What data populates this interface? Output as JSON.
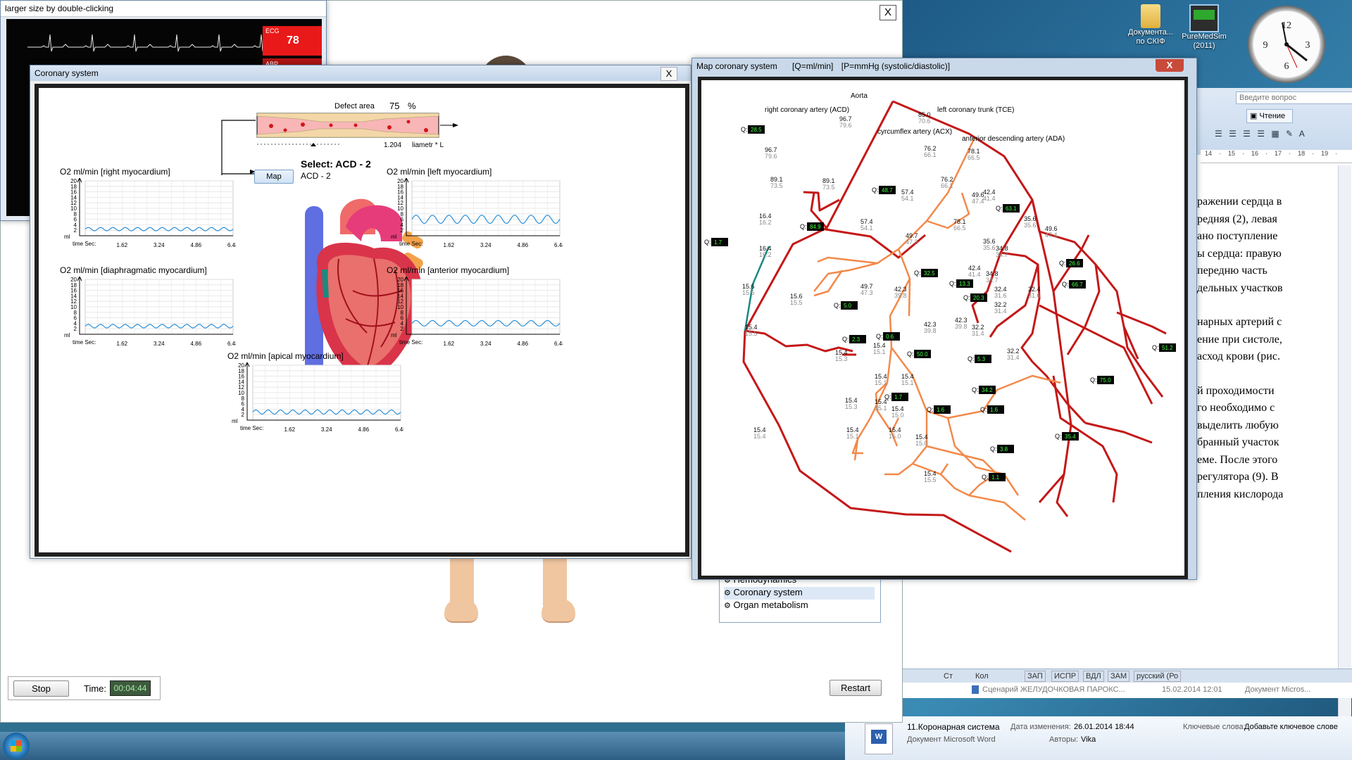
{
  "desktop": {
    "icons": [
      {
        "label": "Документа...\nпо СКІФ"
      },
      {
        "label": "PureMedSim\n(2011)"
      }
    ]
  },
  "main_window": {
    "top_close": "X",
    "stop_label": "Stop",
    "time_label": "Time:",
    "time_value": "00:04:44",
    "restart_label": "Restart",
    "side_menu": [
      {
        "label": "Hemodynamics"
      },
      {
        "label": "Coronary system"
      },
      {
        "label": "Organ metabolism"
      }
    ]
  },
  "monitor_window": {
    "title": "larger size by double-clicking",
    "ecg_label": "ECG",
    "ecg_value": "78",
    "abp_label": "ABP"
  },
  "coronary_window": {
    "title": "Coronary system",
    "close": "X",
    "defect_label": "Defect area",
    "defect_value": "75",
    "defect_unit": "%",
    "diameter_value": "1.204",
    "diameter_label": "liametr * L",
    "select_label": "Select: ACD - 2",
    "select_sub": "ACD - 2",
    "map_button": "Map",
    "charts_common": {
      "yticks": [
        "20",
        "18",
        "16",
        "14",
        "12",
        "10",
        "8",
        "6",
        "4",
        "2"
      ],
      "yunit": "ml",
      "xprefix": "time Sec:",
      "xticks": [
        "1.62",
        "3.24",
        "4.86",
        "6.48"
      ]
    },
    "charts": [
      {
        "title": "O2 ml/min [right myocardium]"
      },
      {
        "title": "O2 ml/min [left myocardium]"
      },
      {
        "title": "O2 ml/min [diaphragmatic myocardium]"
      },
      {
        "title": "O2 ml/min [anterior myocardium]"
      },
      {
        "title": "O2 ml/min [apical myocardium]"
      }
    ]
  },
  "chart_data": [
    {
      "type": "line",
      "title": "O2 ml/min [right myocardium]",
      "ylabel": "ml",
      "xlabel": "time Sec:",
      "ylim": [
        0,
        20
      ],
      "xlim": [
        0,
        6.48
      ],
      "x_ticks": [
        1.62,
        3.24,
        4.86,
        6.48
      ],
      "series": [
        {
          "color": "#2b8fd8",
          "baseline": 1.8,
          "amplitude": 1.2,
          "cycles": 12
        }
      ]
    },
    {
      "type": "line",
      "title": "O2 ml/min [left myocardium]",
      "ylabel": "ml",
      "xlabel": "time Sec:",
      "ylim": [
        0,
        20
      ],
      "xlim": [
        0,
        6.48
      ],
      "x_ticks": [
        1.62,
        3.24,
        4.86,
        6.48
      ],
      "series": [
        {
          "color": "#2b8fd8",
          "baseline": 4.5,
          "amplitude": 3.0,
          "cycles": 9
        }
      ]
    },
    {
      "type": "line",
      "title": "O2 ml/min [diaphragmatic myocardium]",
      "ylabel": "ml",
      "xlabel": "time Sec:",
      "ylim": [
        0,
        20
      ],
      "xlim": [
        0,
        6.48
      ],
      "x_ticks": [
        1.62,
        3.24,
        4.86,
        6.48
      ],
      "series": [
        {
          "color": "#2b8fd8",
          "baseline": 2.3,
          "amplitude": 1.3,
          "cycles": 12
        }
      ]
    },
    {
      "type": "line",
      "title": "O2 ml/min [anterior myocardium]",
      "ylabel": "ml",
      "xlabel": "time Sec:",
      "ylim": [
        0,
        20
      ],
      "xlim": [
        0,
        6.48
      ],
      "x_ticks": [
        1.62,
        3.24,
        4.86,
        6.48
      ],
      "series": [
        {
          "color": "#2b8fd8",
          "baseline": 3.0,
          "amplitude": 2.0,
          "cycles": 9
        }
      ]
    },
    {
      "type": "line",
      "title": "O2 ml/min [apical myocardium]",
      "ylabel": "ml",
      "xlabel": "time Sec:",
      "ylim": [
        0,
        20
      ],
      "xlim": [
        0,
        6.48
      ],
      "x_ticks": [
        1.62,
        3.24,
        4.86,
        6.48
      ],
      "series": [
        {
          "color": "#2b8fd8",
          "baseline": 2.2,
          "amplitude": 1.5,
          "cycles": 12
        }
      ]
    }
  ],
  "map_window": {
    "title": "Map coronary system",
    "units_q": "[Q=ml/min]",
    "units_p": "[P=mmHg (systolic/diastolic)]",
    "close": "X",
    "vessel_labels": [
      "Aorta",
      "right coronary artery (ACD)",
      "left coronary trunk (TCE)",
      "cyrcumflex artery (ACX)",
      "anterior descending artery (ADA)"
    ],
    "flow_labels": [
      {
        "q": "28.5"
      },
      {
        "q": "48.7"
      },
      {
        "q": "84.9"
      },
      {
        "q": "1.7"
      },
      {
        "q": "63.1"
      },
      {
        "q": "26.6"
      },
      {
        "q": "32.5"
      },
      {
        "q": "13.3"
      },
      {
        "q": "20.3"
      },
      {
        "q": "66.7"
      },
      {
        "q": "5.0"
      },
      {
        "q": "2.3"
      },
      {
        "q": "0.6"
      },
      {
        "q": "50.0"
      },
      {
        "q": "51.2"
      },
      {
        "q": "5.3"
      },
      {
        "q": "75.0"
      },
      {
        "q": "34.2"
      },
      {
        "q": "1.7"
      },
      {
        "q": "1.6"
      },
      {
        "q": "1.6"
      },
      {
        "q": "35.4"
      },
      {
        "q": "3.8"
      },
      {
        "q": "1.1"
      }
    ],
    "pressure_labels": [
      {
        "s": "96.7",
        "d": "79.6"
      },
      {
        "s": "85.0",
        "d": "70.6"
      },
      {
        "s": "96.7",
        "d": "79.6"
      },
      {
        "s": "76.2",
        "d": "66.1"
      },
      {
        "s": "78.1",
        "d": "66.5"
      },
      {
        "s": "89.1",
        "d": "73.5"
      },
      {
        "s": "89.1",
        "d": "73.5"
      },
      {
        "s": "76.2",
        "d": "66.1"
      },
      {
        "s": "57.4",
        "d": "54.1"
      },
      {
        "s": "49.6",
        "d": "47.4"
      },
      {
        "s": "42.4",
        "d": "41.4"
      },
      {
        "s": "16.4",
        "d": "16.2"
      },
      {
        "s": "57.4",
        "d": "54.1"
      },
      {
        "s": "78.1",
        "d": "66.5"
      },
      {
        "s": "35.6",
        "d": "35.6"
      },
      {
        "s": "49.6",
        "d": "47.4"
      },
      {
        "s": "49.7",
        "d": "47.3"
      },
      {
        "s": "35.6",
        "d": "35.6"
      },
      {
        "s": "34.8",
        "d": "34.7"
      },
      {
        "s": "16.4",
        "d": "16.2"
      },
      {
        "s": "42.4",
        "d": "41.4"
      },
      {
        "s": "34.8",
        "d": "34.7"
      },
      {
        "s": "15.6",
        "d": "15.5"
      },
      {
        "s": "49.7",
        "d": "47.3"
      },
      {
        "s": "42.3",
        "d": "39.8"
      },
      {
        "s": "32.4",
        "d": "31.6"
      },
      {
        "s": "32.4",
        "d": "31.6"
      },
      {
        "s": "15.6",
        "d": "15.5"
      },
      {
        "s": "32.2",
        "d": "31.4"
      },
      {
        "s": "15.4",
        "d": "15.5"
      },
      {
        "s": "42.3",
        "d": "39.8"
      },
      {
        "s": "42.3",
        "d": "39.8"
      },
      {
        "s": "32.2",
        "d": "31.4"
      },
      {
        "s": "15.4",
        "d": "15.3"
      },
      {
        "s": "15.4",
        "d": "15.1"
      },
      {
        "s": "32.2",
        "d": "31.4"
      },
      {
        "s": "15.4",
        "d": "15.1"
      },
      {
        "s": "15.4",
        "d": "15.1"
      },
      {
        "s": "15.4",
        "d": "15.3"
      },
      {
        "s": "15.4",
        "d": "15.1"
      },
      {
        "s": "15.4",
        "d": "15.0"
      },
      {
        "s": "15.4",
        "d": "15.4"
      },
      {
        "s": "15.4",
        "d": "15.1"
      },
      {
        "s": "15.4",
        "d": "15.0"
      },
      {
        "s": "15.4",
        "d": "15.0"
      },
      {
        "s": "15.4",
        "d": "15.5"
      }
    ]
  },
  "word": {
    "search_placeholder": "Введите вопрос",
    "read_button": "Чтение",
    "ruler": [
      "14",
      "·",
      "15",
      "·",
      "16",
      "·",
      "17",
      "·",
      "18",
      "·",
      "19",
      "·"
    ],
    "lines": [
      "ражении сердца в",
      "редняя (2), левая",
      "ано поступление",
      "ы сердца: правую",
      "передню часть",
      "дельных участков",
      "",
      "нарных артерий с",
      "ение при систоле,",
      "асход крови (рис.",
      "",
      "й проходимости",
      "го необходимо с",
      "выделить любую",
      "бранный участок",
      "еме. После этого",
      "регулятора (9). В",
      "пления кислорода"
    ],
    "status": [
      "Ст",
      "Кол",
      "ЗАП",
      "ИСПР",
      "ВДЛ",
      "ЗАМ",
      "русский (Ро"
    ],
    "explorer_item": "Сценарий ЖЕЛУДОЧКОВАЯ ПАРОКС...",
    "explorer_date": "15.02.2014 12:01",
    "explorer_type": "Документ Micros...",
    "file_name": "11.Коронарная система",
    "file_type": "Документ Microsoft Word",
    "modified_label": "Дата изменения:",
    "modified_value": "26.01.2014 18:44",
    "authors_label": "Авторы:",
    "authors_value": "Vika",
    "keywords_label": "Ключевые слова:",
    "keywords_value": "Добавьте ключевое слове"
  }
}
